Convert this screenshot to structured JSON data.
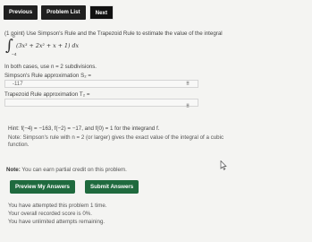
{
  "nav": {
    "previous": "Previous",
    "problem_list": "Problem List",
    "next": "Next"
  },
  "problem": {
    "intro": "(1 point) Use Simpson's Rule and the Trapezoid Rule to estimate the value of the integral",
    "integral_upper": "0",
    "integral_lower": "−4",
    "integrand": "(3x³ + 2x² + x + 1) dx",
    "subdivisions": "In both cases, use n = 2 subdivisions.",
    "simpson_label": "Simpson's Rule approximation S₂ =",
    "simpson_value": "-117",
    "trapezoid_label": "Trapezoid Rule approximation T₂ =",
    "trapezoid_value": "",
    "matrix_icon_glyph": "⠿"
  },
  "hint": {
    "line": "Hint: f(−4) = −163, f(−2) = −17, and f(0) = 1 for the integrand f.",
    "note_line1": "Note: Simpson's rule with n = 2 (or larger) gives the exact value of the integral of a cubic",
    "note_line2": "function."
  },
  "note": {
    "label": "Note:",
    "text": " You can earn partial credit on this problem."
  },
  "actions": {
    "preview": "Preview My Answers",
    "submit": "Submit Answers",
    "color": "#1f6a3e"
  },
  "status": {
    "attempted": "You have attempted this problem 1 time.",
    "score": "Your overall recorded score is 0%.",
    "remaining": "You have unlimited attempts remaining."
  }
}
